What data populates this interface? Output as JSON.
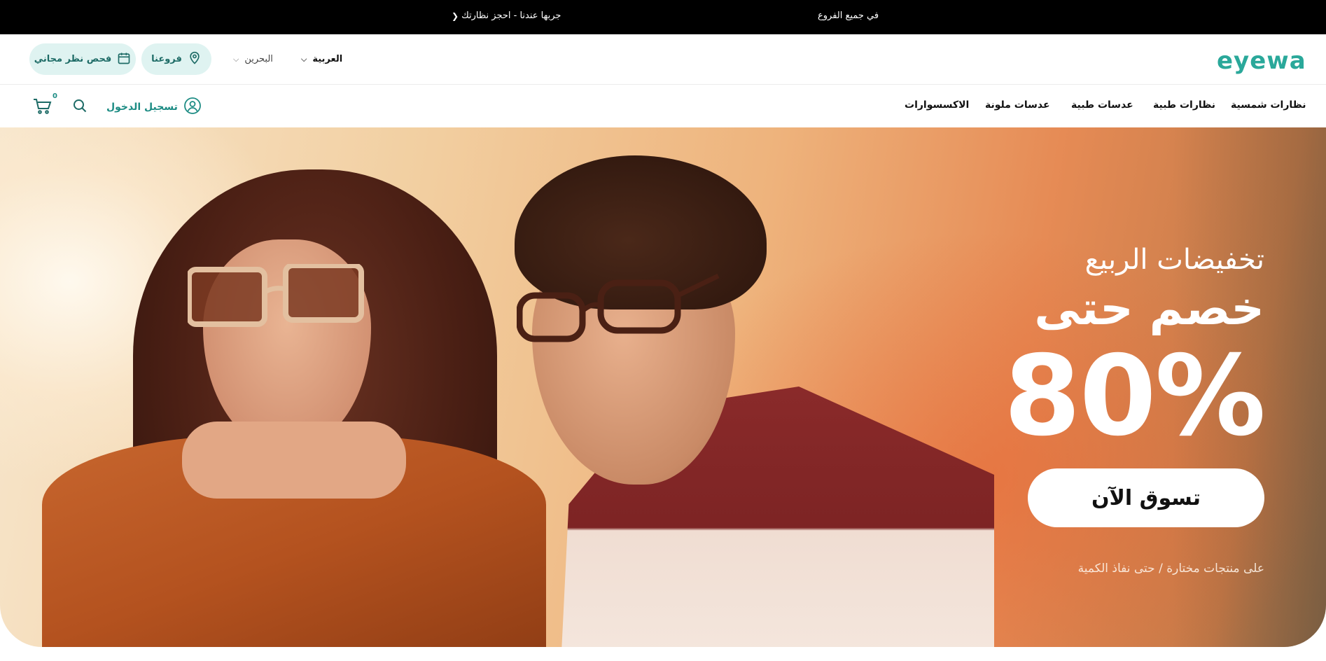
{
  "announcement": {
    "branches_text": "في جميع الفروع",
    "try_text": "جربها عندنا - احجز نظارتك",
    "chevron_icon": "chevron-left-icon"
  },
  "header": {
    "logo_text": "eyewa",
    "language": "العربية",
    "country": "البحرين",
    "branches_button": "فروعنا",
    "eye_test_button": "فحص نظر مجاني"
  },
  "nav": {
    "items": [
      "نظارات شمسية",
      "نظارات طبية",
      "عدسات طبية",
      "عدسات ملونة",
      "الاكسسوارات"
    ],
    "login": "تسجيل الدخول",
    "cart_count": "0"
  },
  "hero": {
    "subtitle": "تخفيضات الربيع",
    "title": "خصم حتى",
    "percent": "80%",
    "cta": "تسوق الآن",
    "disclaimer": "على منتجات مختارة / حتى نفاذ الكمية"
  },
  "colors": {
    "brand": "#2aa89a",
    "pill_bg": "#dff3f1",
    "topbar_bg": "#000000"
  }
}
